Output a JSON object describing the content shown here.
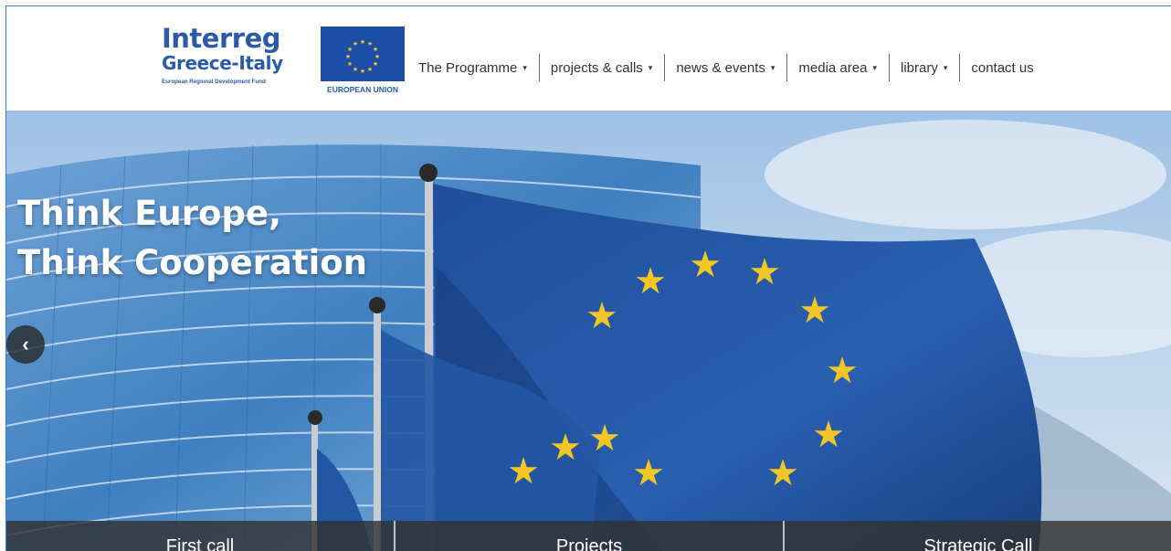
{
  "logo": {
    "brand": "Interreg",
    "region": "Greece-Italy",
    "fund": "European Regional Development Fund",
    "eu_label": "EUROPEAN UNION"
  },
  "nav": {
    "programme": "The Programme",
    "projects_calls": "projects & calls",
    "news_events": "news & events",
    "media_area": "media area",
    "library": "library",
    "contact": "contact us",
    "caret": "▾"
  },
  "hero": {
    "title_line1": "Think Europe,",
    "title_line2": "Think Cooperation",
    "prev_glyph": "‹"
  },
  "cta": {
    "first_call": "First call",
    "projects": "Projects",
    "strategic_call": "Strategic Call"
  },
  "colors": {
    "brand_blue": "#2b5aa6",
    "eu_blue": "#1d4ea5",
    "star_gold": "#f3c623"
  }
}
